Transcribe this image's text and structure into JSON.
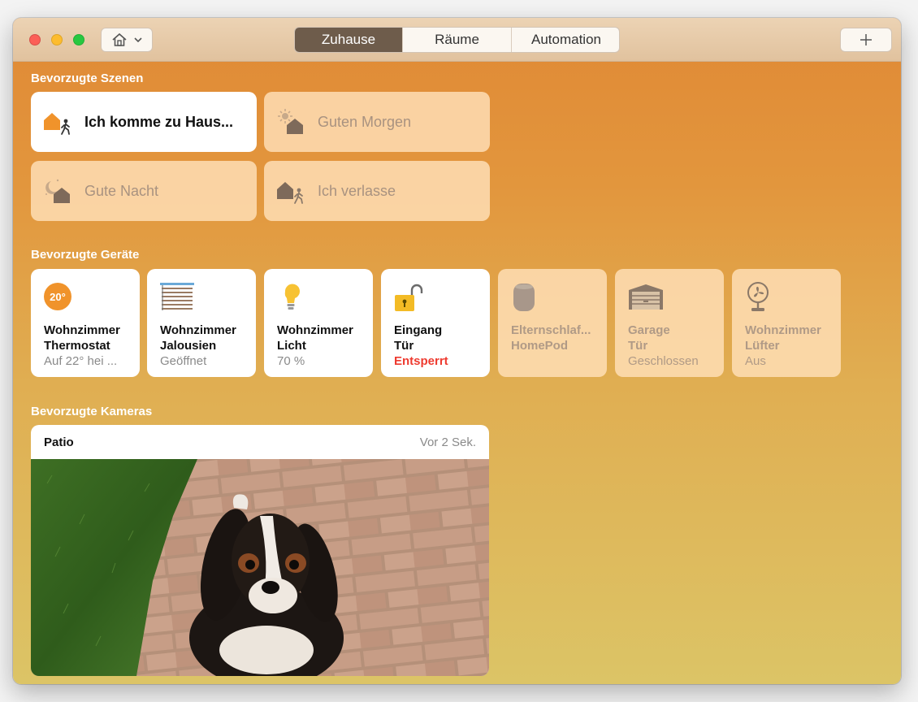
{
  "window": {
    "tabs": [
      {
        "label": "Zuhause",
        "active": true
      },
      {
        "label": "Räume",
        "active": false
      },
      {
        "label": "Automation",
        "active": false
      }
    ],
    "home_icon": "house-icon",
    "add_icon": "plus-icon"
  },
  "sections": {
    "scenes": "Bevorzugte Szenen",
    "devices": "Bevorzugte Geräte",
    "cameras": "Bevorzugte Kameras"
  },
  "scenes": [
    {
      "label": "Ich komme zu Haus...",
      "active": true,
      "icon": "arrive-home-icon"
    },
    {
      "label": "Guten Morgen",
      "active": false,
      "icon": "good-morning-icon"
    },
    {
      "label": "Gute Nacht",
      "active": false,
      "icon": "good-night-icon"
    },
    {
      "label": "Ich verlasse",
      "active": false,
      "icon": "leave-home-icon"
    }
  ],
  "devices": [
    {
      "line1": "Wohnzimmer",
      "line2": "Thermostat",
      "status": "Auf 22° hei ...",
      "active": true,
      "icon": "thermostat-icon",
      "badge": "20°"
    },
    {
      "line1": "Wohnzimmer",
      "line2": "Jalousien",
      "status": "Geöffnet",
      "active": true,
      "icon": "blinds-icon"
    },
    {
      "line1": "Wohnzimmer",
      "line2": "Licht",
      "status": "70 %",
      "active": true,
      "icon": "lightbulb-icon"
    },
    {
      "line1": "Eingang",
      "line2": "Tür",
      "status": "Entsperrt",
      "active": true,
      "icon": "unlocked-icon",
      "status_color": "#ee3b30"
    },
    {
      "line1": "Elternschlaf...",
      "line2": "HomePod",
      "status": "",
      "active": false,
      "icon": "homepod-icon"
    },
    {
      "line1": "Garage",
      "line2": "Tür",
      "status": "Geschlossen",
      "active": false,
      "icon": "garage-icon"
    },
    {
      "line1": "Wohnzimmer",
      "line2": "Lüfter",
      "status": "Aus",
      "active": false,
      "icon": "fan-icon"
    }
  ],
  "camera": {
    "name": "Patio",
    "time": "Vor 2 Sek."
  },
  "colors": {
    "accent": "#e08935",
    "active_tab": "#6e5c4b",
    "alert": "#ee3b30"
  }
}
